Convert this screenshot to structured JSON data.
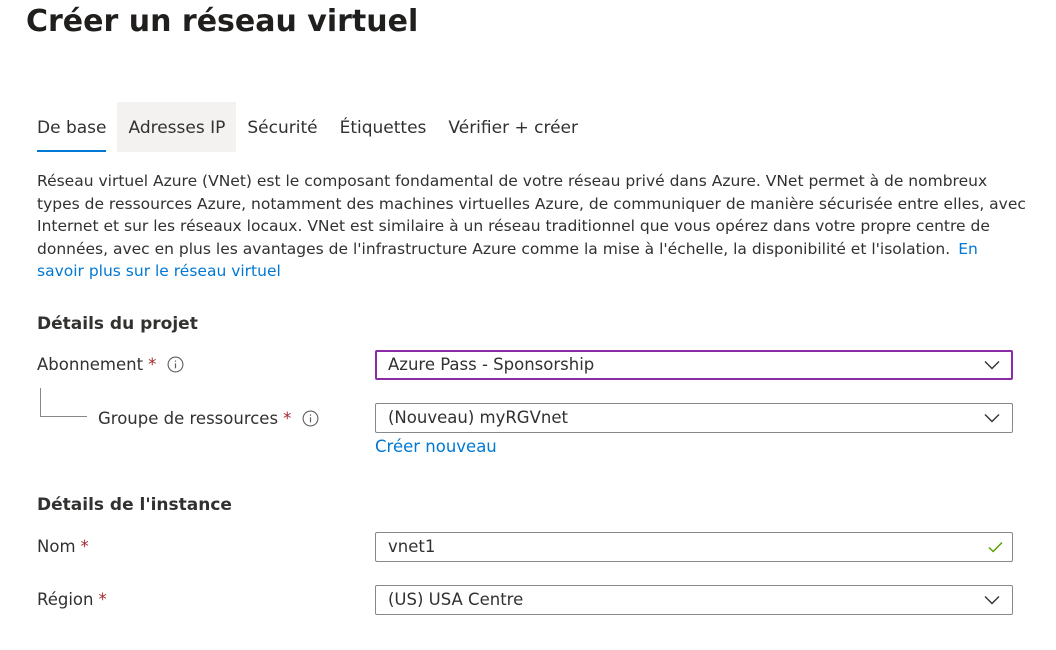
{
  "page": {
    "title": "Créer un réseau virtuel"
  },
  "tabs": [
    {
      "label": "De base",
      "state": "active"
    },
    {
      "label": "Adresses IP",
      "state": "hover"
    },
    {
      "label": "Sécurité",
      "state": "normal"
    },
    {
      "label": "Étiquettes",
      "state": "normal"
    },
    {
      "label": "Vérifier + créer",
      "state": "normal"
    }
  ],
  "description": {
    "text": "Réseau virtuel Azure (VNet) est le composant fondamental de votre réseau privé dans Azure. VNet permet à de nombreux types de ressources Azure, notamment des machines virtuelles Azure, de communiquer de manière sécurisée entre elles, avec Internet et sur les réseaux locaux. VNet est similaire à un réseau traditionnel que vous opérez dans votre propre centre de données, avec en plus les avantages de l'infrastructure Azure comme la mise à l'échelle, la disponibilité et l'isolation.",
    "link": "En savoir plus sur le réseau virtuel"
  },
  "project_details": {
    "heading": "Détails du projet",
    "subscription": {
      "label": "Abonnement",
      "required_mark": "*",
      "value": "Azure Pass - Sponsorship",
      "icon": "info-icon"
    },
    "resource_group": {
      "label": "Groupe de ressources",
      "required_mark": "*",
      "value": "(Nouveau) myRGVnet",
      "create_new": "Créer nouveau",
      "icon": "info-icon"
    }
  },
  "instance_details": {
    "heading": "Détails de l'instance",
    "name": {
      "label": "Nom",
      "required_mark": "*",
      "value": "vnet1",
      "valid_icon": "checkmark-icon"
    },
    "region": {
      "label": "Région",
      "required_mark": "*",
      "value": "(US) USA Centre"
    }
  },
  "colors": {
    "accent": "#0078d4",
    "required": "#a4262c",
    "focus_border": "#8a2da5",
    "valid": "#57a300",
    "tab_hover_bg": "#f3f2f1"
  }
}
